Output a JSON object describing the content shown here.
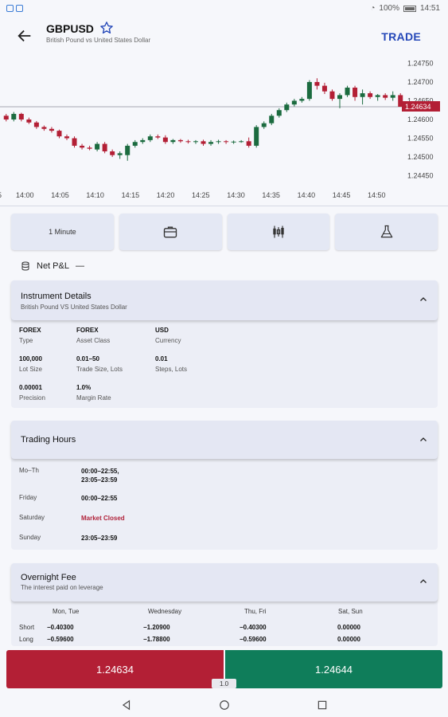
{
  "status": {
    "battery": "100%",
    "time": "14:51"
  },
  "header": {
    "symbol": "GBPUSD",
    "description": "British Pound vs United States Dollar",
    "trade_label": "TRADE"
  },
  "chart_data": {
    "type": "candlestick",
    "x_ticks": [
      "5",
      "14:00",
      "14:05",
      "14:10",
      "14:15",
      "14:20",
      "14:25",
      "14:30",
      "14:35",
      "14:40",
      "14:45",
      "14:50"
    ],
    "y_ticks": [
      "1.24750",
      "1.24700",
      "1.24650",
      "1.24600",
      "1.24550",
      "1.24500",
      "1.24450"
    ],
    "current_price": "1.24634",
    "ylim": [
      1.2443,
      1.2477
    ],
    "up_color": "#1b6b3f",
    "down_color": "#b31f35",
    "candles": [
      [
        1.2461,
        1.24615,
        1.24595,
        1.246
      ],
      [
        1.246,
        1.2462,
        1.24595,
        1.24615
      ],
      [
        1.24615,
        1.24618,
        1.24595,
        1.246
      ],
      [
        1.246,
        1.24605,
        1.24588,
        1.24592
      ],
      [
        1.24592,
        1.24596,
        1.24575,
        1.2458
      ],
      [
        1.2458,
        1.24584,
        1.2457,
        1.24575
      ],
      [
        1.24575,
        1.2458,
        1.24565,
        1.2457
      ],
      [
        1.2457,
        1.24573,
        1.2455,
        1.24555
      ],
      [
        1.24555,
        1.2456,
        1.24545,
        1.2455
      ],
      [
        1.2455,
        1.24555,
        1.24525,
        1.2453
      ],
      [
        1.2453,
        1.24535,
        1.2452,
        1.24525
      ],
      [
        1.24525,
        1.2453,
        1.24518,
        1.24522
      ],
      [
        1.2452,
        1.2454,
        1.24515,
        1.24535
      ],
      [
        1.24535,
        1.2454,
        1.2451,
        1.24515
      ],
      [
        1.24515,
        1.2452,
        1.245,
        1.24505
      ],
      [
        1.24505,
        1.24515,
        1.24495,
        1.2451
      ],
      [
        1.24505,
        1.24535,
        1.2449,
        1.2453
      ],
      [
        1.2453,
        1.24545,
        1.24525,
        1.2454
      ],
      [
        1.2454,
        1.2455,
        1.24535,
        1.24545
      ],
      [
        1.24545,
        1.2456,
        1.2454,
        1.24555
      ],
      [
        1.24555,
        1.2456,
        1.24548,
        1.24552
      ],
      [
        1.24552,
        1.24558,
        1.24535,
        1.2454
      ],
      [
        1.2454,
        1.24548,
        1.24535,
        1.24545
      ],
      [
        1.24545,
        1.24548,
        1.24538,
        1.24542
      ],
      [
        1.24542,
        1.24546,
        1.24536,
        1.2454
      ],
      [
        1.2454,
        1.24545,
        1.24535,
        1.24542
      ],
      [
        1.24542,
        1.24546,
        1.2453,
        1.24535
      ],
      [
        1.24535,
        1.24545,
        1.2453,
        1.2454
      ],
      [
        1.2454,
        1.24546,
        1.24535,
        1.24542
      ],
      [
        1.24542,
        1.24545,
        1.24535,
        1.2454
      ],
      [
        1.2454,
        1.24544,
        1.24535,
        1.24541
      ],
      [
        1.24541,
        1.24545,
        1.24538,
        1.24542
      ],
      [
        1.24542,
        1.24552,
        1.24525,
        1.2453
      ],
      [
        1.2453,
        1.24585,
        1.24525,
        1.2458
      ],
      [
        1.2458,
        1.24595,
        1.24575,
        1.2459
      ],
      [
        1.2459,
        1.24615,
        1.24585,
        1.2461
      ],
      [
        1.2461,
        1.2463,
        1.24605,
        1.24625
      ],
      [
        1.24625,
        1.24645,
        1.2462,
        1.2464
      ],
      [
        1.2464,
        1.24655,
        1.24635,
        1.2465
      ],
      [
        1.2465,
        1.2466,
        1.24645,
        1.24655
      ],
      [
        1.24655,
        1.24705,
        1.2465,
        1.247
      ],
      [
        1.247,
        1.2471,
        1.2468,
        1.2469
      ],
      [
        1.2469,
        1.24698,
        1.24668,
        1.24675
      ],
      [
        1.24675,
        1.2468,
        1.2465,
        1.24655
      ],
      [
        1.24655,
        1.2467,
        1.2463,
        1.24665
      ],
      [
        1.24665,
        1.2469,
        1.2466,
        1.24685
      ],
      [
        1.24685,
        1.2469,
        1.2465,
        1.2466
      ],
      [
        1.2466,
        1.2468,
        1.2464,
        1.2467
      ],
      [
        1.2467,
        1.24675,
        1.24655,
        1.2466
      ],
      [
        1.2466,
        1.24668,
        1.2465,
        1.24665
      ],
      [
        1.24665,
        1.2467,
        1.24652,
        1.24658
      ],
      [
        1.24658,
        1.24675,
        1.2465,
        1.24665
      ],
      [
        1.24665,
        1.2467,
        1.2464,
        1.24634
      ]
    ]
  },
  "tools": {
    "interval_label": "1 Minute"
  },
  "pnl": {
    "label": "Net P&L",
    "value": "—"
  },
  "instrument": {
    "title": "Instrument Details",
    "subtitle": "British Pound VS United States Dollar",
    "items": [
      {
        "value": "FOREX",
        "label": "Type"
      },
      {
        "value": "FOREX",
        "label": "Asset Class"
      },
      {
        "value": "USD",
        "label": "Currency"
      },
      {
        "value": "100,000",
        "label": "Lot Size"
      },
      {
        "value": "0.01–50",
        "label": "Trade Size, Lots"
      },
      {
        "value": "0.01",
        "label": "Steps, Lots"
      },
      {
        "value": "0.00001",
        "label": "Precision"
      },
      {
        "value": "1.0%",
        "label": "Margin Rate"
      }
    ]
  },
  "hours": {
    "title": "Trading Hours",
    "rows": [
      {
        "day": "Mo–Th",
        "time": "00:00–22:55,",
        "time2": "23:05–23:59"
      },
      {
        "day": "Friday",
        "time": "00:00–22:55",
        "time2": ""
      },
      {
        "day": "Saturday",
        "time": "Market Closed",
        "time2": ""
      },
      {
        "day": "Sunday",
        "time": "23:05–23:59",
        "time2": ""
      }
    ]
  },
  "fee": {
    "title": "Overnight Fee",
    "subtitle": "The interest paid on leverage",
    "columns": [
      "Mon, Tue",
      "Wednesday",
      "Thu, Fri",
      "Sat, Sun"
    ],
    "rows": [
      {
        "label": "Short",
        "values": [
          "−0.40300",
          "−1.20900",
          "−0.40300",
          "0.00000"
        ]
      },
      {
        "label": "Long",
        "values": [
          "−0.59600",
          "−1.78800",
          "−0.59600",
          "0.00000"
        ]
      }
    ]
  },
  "order": {
    "sell_price": "1.24634",
    "buy_price": "1.24644",
    "lot": "1.0"
  }
}
